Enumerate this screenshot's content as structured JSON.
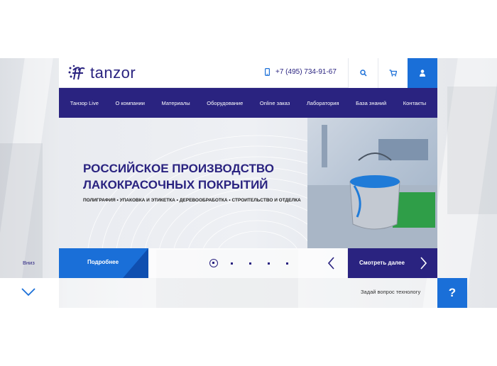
{
  "brand": {
    "name": "tanzor"
  },
  "header": {
    "phone": "+7 (495) 734-91-67"
  },
  "nav": {
    "items": [
      "Танзор Live",
      "О компании",
      "Материалы",
      "Оборудование",
      "Online заказ",
      "Лаборатория",
      "База знаний",
      "Контакты"
    ]
  },
  "hero": {
    "title_line1": "РОССИЙСКОЕ ПРОИЗВОДСТВО",
    "title_line2": "ЛАКОКРАСОЧНЫХ ПОКРЫТИЙ",
    "tags": [
      "ПОЛИГРАФИЯ",
      "УПАКОВКА И ЭТИКЕТКА",
      "ДЕРЕВООБРАБОТКА",
      "СТРОИТЕЛЬСТВО И ОТДЕЛКА"
    ]
  },
  "slider": {
    "more_label": "Подробнее",
    "see_more_label": "Смотреть далее"
  },
  "down": {
    "label": "Вниз"
  },
  "ask": {
    "label": "Задай вопрос технологу",
    "button": "?"
  },
  "colors": {
    "primary": "#2a2380",
    "accent": "#1a6fd8"
  },
  "icons": {
    "phone": "phone-icon",
    "search": "search-icon",
    "cart": "cart-icon",
    "user": "user-icon"
  }
}
